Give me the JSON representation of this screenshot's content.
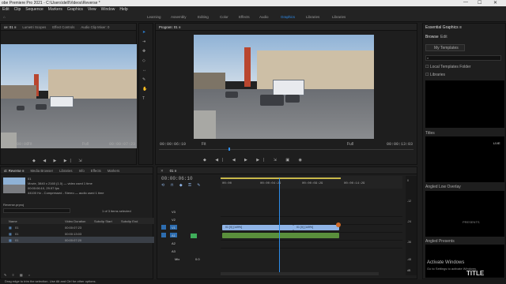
{
  "titlebar": {
    "title": "obe Premiere Pro 2021 - C:\\Users\\dell\\Videos\\Reverse *",
    "minimize": "—",
    "maximize": "☐",
    "close": "✕"
  },
  "menu": [
    "Edit",
    "Clip",
    "Sequence",
    "Markers",
    "Graphics",
    "View",
    "Window",
    "Help"
  ],
  "workspaces": {
    "items": [
      "Learning",
      "Assembly",
      "Editing",
      "Color",
      "Effects",
      "Audio",
      "Graphics",
      "Libraries",
      "Libraries"
    ],
    "active_index": 6,
    "home": "⌂"
  },
  "source_panel": {
    "tabs": [
      "ce: 01 ≡",
      "Lumetri Scopes",
      "Effect Controls",
      "Audio Clip Mixer: 0"
    ],
    "timecode_left": "00:00:00:00",
    "fit": "Fit",
    "full": "Full",
    "timecode_right": "00:00:07:23"
  },
  "program_panel": {
    "title": "Program: 01 ≡",
    "timecode_left": "00:00:06:10",
    "fit": "Fit",
    "full": "Full",
    "timecode_right": "00:00:13:03"
  },
  "project_panel": {
    "tabs": [
      "ct: Reverse ≡",
      "Media Browser",
      "Libraries",
      "Info",
      "Effects",
      "Markers"
    ],
    "clip_name": "01",
    "clip_info_1": "Movie, 3840 x 2160 (1.0) — video used 1 time",
    "clip_info_2": "00:00:06:10, 29.97 fps",
    "clip_info_3": "44100 Hz - Compressed - Stereo — audio used 1 time",
    "project_file": "Reverse.prproj",
    "selection": "1 of 3 items selected",
    "columns": [
      "Name",
      "Video Duration",
      "Subclip Start",
      "Subclip End"
    ],
    "rows": [
      {
        "name": "01",
        "duration": "00:00:07:23"
      },
      {
        "name": "01",
        "duration": "00:00:13:03"
      },
      {
        "name": "01",
        "duration": "00:00:07:20"
      }
    ]
  },
  "timeline": {
    "tab": "01 ≡",
    "timecode": "00:00:06:10",
    "ruler": [
      "00:00",
      "00:00:04:29",
      "00:00:09:29",
      "00:00:14:29"
    ],
    "video_tracks": [
      "V3",
      "V2",
      "V1"
    ],
    "audio_tracks": [
      "A1",
      "A2",
      "A3"
    ],
    "master": "Mix",
    "master_value": "0.0",
    "clip_label_1": "01 [V] [149%]",
    "clip_label_2": "01 [V] [149%]",
    "meter_labels": [
      "0",
      "-12",
      "-24",
      "-36",
      "-48",
      "dB"
    ]
  },
  "essential_graphics": {
    "title": "Essential Graphics ≡",
    "tabs": [
      "Browse",
      "Edit"
    ],
    "my_templates": "My Templates",
    "local_templates": "Local Templates Folder",
    "libraries": "Libraries",
    "section_1": "Titles",
    "live": "LIVE",
    "section_2": "Angled Low Overlay",
    "presents": "PRESENTS",
    "section_3": "Angled Presents",
    "title_text": "TITLE"
  },
  "activate": {
    "line1": "Activate Windows",
    "line2": "Go to Settings to activate Windows."
  },
  "status": "Drag edge to trim the selection. Use Alt and Ctrl for other options.",
  "colors": {
    "accent": "#2d8ceb",
    "video_clip": "#8fb4e6",
    "audio_clip": "#5a8f3c",
    "playhead": "#2d8ceb"
  }
}
